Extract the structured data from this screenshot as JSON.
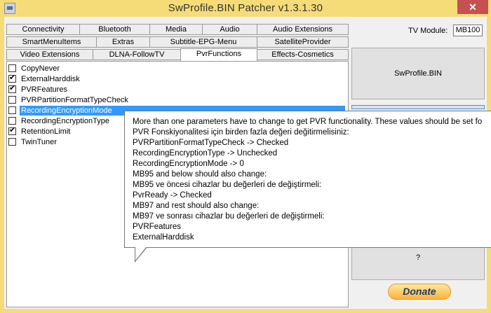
{
  "window": {
    "title": "SwProfile.BIN Patcher v1.3.1.30",
    "close": "✕"
  },
  "tabs": {
    "row1": [
      "Connectivity",
      "Bluetooth",
      "Media",
      "Audio",
      "Audio Extensions"
    ],
    "row2": [
      "SmartMenuItems",
      "Extras",
      "Subtitle-EPG-Menu",
      "SatelliteProvider"
    ],
    "row3": [
      "Video Extensions",
      "DLNA-FollowTV",
      "PvrFunctions",
      "Effects-Cosmetics"
    ],
    "active": "PvrFunctions"
  },
  "options": [
    {
      "label": "CopyNever",
      "checked": false,
      "selected": false
    },
    {
      "label": "ExternalHarddisk",
      "checked": true,
      "selected": false
    },
    {
      "label": "PVRFeatures",
      "checked": true,
      "selected": false
    },
    {
      "label": "PVRPartitionFormatTypeCheck",
      "checked": false,
      "selected": false
    },
    {
      "label": "RecordingEncryptionMode",
      "checked": false,
      "selected": true
    },
    {
      "label": "RecordingEncryptionType",
      "checked": false,
      "selected": false
    },
    {
      "label": "RetentionLimit",
      "checked": true,
      "selected": false
    },
    {
      "label": "TwinTuner",
      "checked": false,
      "selected": false
    }
  ],
  "right": {
    "tv_module_label": "TV Module:",
    "tv_module_value": "MB100",
    "swprofile_button": "SwProfile.BIN",
    "help_button": "?",
    "donate_button": "Donate"
  },
  "tooltip": {
    "lines": [
      "More than one parameters have to change to get PVR functionality. These values should be set fo",
      "PVR Fonskiyonalitesi için birden fazla değeri değitirmelisiniz:",
      "PVRPartitionFormatTypeCheck -> Checked",
      "RecordingEncryptionType -> Unchecked",
      "RecordingEncryptionMode -> 0",
      "MB95 and below should also change:",
      "MB95 ve öncesi cihazlar bu değerleri de değiştirmeli:",
      "PvrReady -> Checked",
      "MB97 and rest should also change:",
      "MB97 ve sonrası cihazlar bu değerleri de değiştirmeli:",
      "PVRFeatures",
      "ExternalHarddisk"
    ]
  }
}
